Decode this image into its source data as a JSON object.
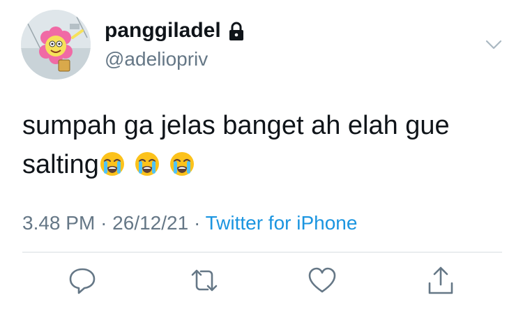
{
  "tweet": {
    "display_name": "panggiladel",
    "handle": "@adeliopriv",
    "text_line1": "sumpah ga jelas banget ah elah gue",
    "text_line2": "salting",
    "emojis": [
      "loudly-crying-face",
      "loudly-crying-face",
      "loudly-crying-face"
    ],
    "time": "3.48 PM",
    "separator": "·",
    "date": "26/12/21",
    "source": "Twitter for iPhone"
  },
  "icons": {
    "lock": "lock-icon",
    "menu": "chevron-down-icon",
    "reply": "reply-icon",
    "retweet": "retweet-icon",
    "like": "heart-icon",
    "share": "share-icon"
  },
  "colors": {
    "text": "#0f1419",
    "muted": "#657786",
    "link": "#1b95e0",
    "divider": "#d8dde1"
  }
}
